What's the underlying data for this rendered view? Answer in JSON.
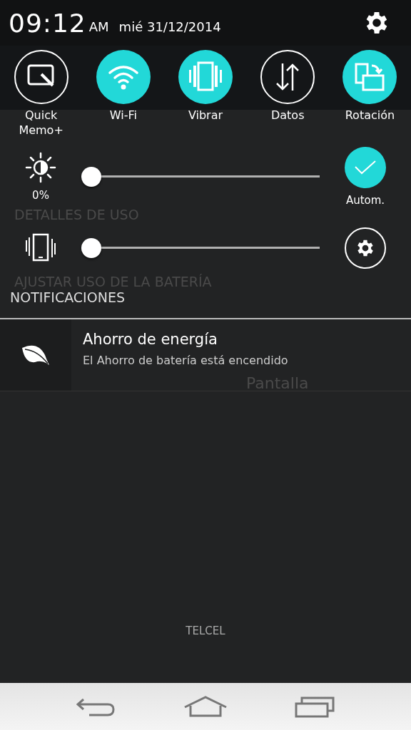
{
  "status_bar": {
    "time": "09:12",
    "meridiem": "AM",
    "date": "mié 31/12/2014"
  },
  "quick_settings": [
    {
      "kind": "memo",
      "label": "Quick Memo+",
      "on": false
    },
    {
      "kind": "wifi",
      "label": "Wi-Fi",
      "on": true
    },
    {
      "kind": "vibrate",
      "label": "Vibrar",
      "on": true
    },
    {
      "kind": "data",
      "label": "Datos",
      "on": false
    },
    {
      "kind": "rotation",
      "label": "Rotación",
      "on": true
    }
  ],
  "brightness": {
    "level": 0,
    "reading": "0%",
    "auto": {
      "label": "Autom.",
      "on": true
    }
  },
  "volume": {
    "level": 0
  },
  "background_app": {
    "section_1": "DETALLES DE USO",
    "section_2": "AJUSTAR USO DE LA BATERÍA",
    "button": "Pantalla"
  },
  "notifications": {
    "header": "NOTIFICACIONES",
    "items": [
      {
        "title": "Ahorro de energía",
        "text": "El Ahorro de batería está encendido"
      }
    ]
  },
  "carrier": "TELCEL"
}
